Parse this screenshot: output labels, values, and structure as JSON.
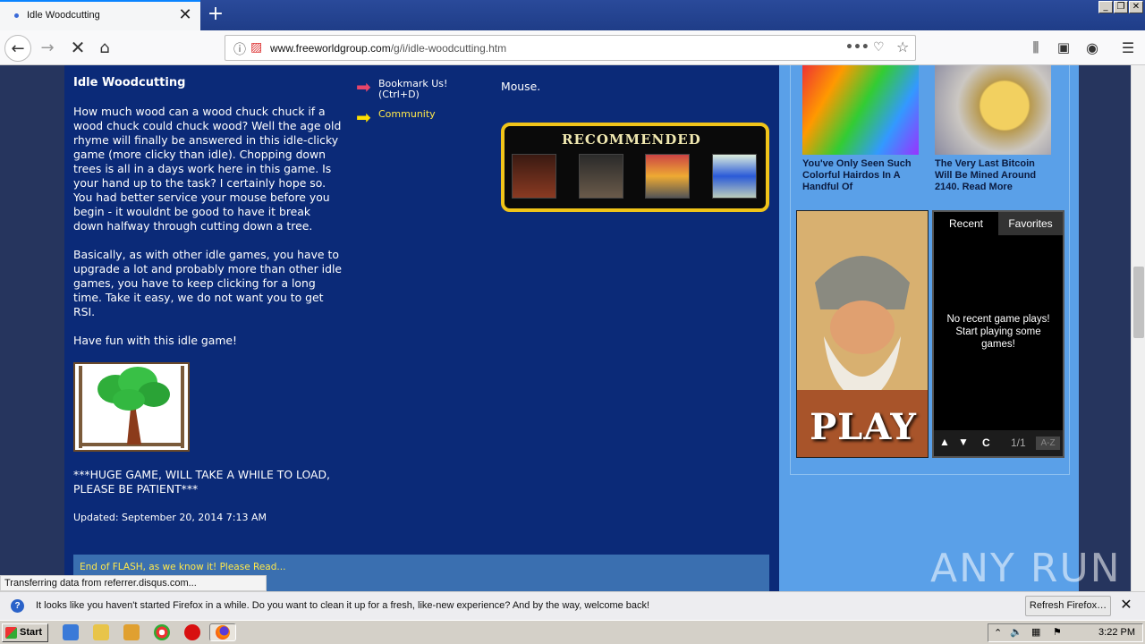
{
  "browser": {
    "tab_title": "Idle Woodcutting",
    "url_domain": "www.freeworldgroup.com",
    "url_path": "/g/i/idle-woodcutting.htm",
    "status": "Transferring data from referrer.disqus.com...",
    "accent": "#0a84ff"
  },
  "article": {
    "title": "Idle Woodcutting",
    "paragraphs": [
      "How much wood can a wood chuck chuck if a wood chuck could chuck wood? Well the age old rhyme will finally be answered in this idle-clicky game (more clicky than idle). Chopping down trees is all in a days work here in this game. Is your hand up to the task? I certainly hope so. You had better service your mouse before you begin - it wouldnt be good to have it break down halfway through cutting down a tree.",
      "Basically, as with other idle games, you have to upgrade a lot and probably more than other idle games, you have to keep clicking for a long time. Take it easy, we do not want you to get RSI.",
      "Have fun with this idle game!"
    ],
    "warning": "***HUGE GAME, WILL TAKE A WHILE TO LOAD, PLEASE BE PATIENT***",
    "updated": "Updated: September 20, 2014 7:13 AM",
    "controls_tail": "Mouse."
  },
  "sidebar_links": {
    "bookmark": "Bookmark Us!",
    "bookmark_shortcut": "(Ctrl+D)",
    "community": "Community"
  },
  "recommended": {
    "title": "RECOMMENDED"
  },
  "flash_notice": "End of FLASH, as we know it! Please Read...",
  "ads": [
    {
      "caption": "You've Only Seen Such Colorful Hairdos In A Handful Of"
    },
    {
      "caption": "The Very Last Bitcoin Will Be Mined Around 2140. Read More"
    }
  ],
  "play_label": "PLAY",
  "recent_widget": {
    "tab_recent": "Recent",
    "tab_favorites": "Favorites",
    "empty_message": "No recent game plays! Start playing some games!",
    "clear": "C",
    "page": "1/1",
    "sort": "A-Z"
  },
  "notification": {
    "message": "It looks like you haven't started Firefox in a while. Do you want to clean it up for a fresh, like-new experience? And by the way, welcome back!",
    "button": "Refresh Firefox…"
  },
  "taskbar": {
    "start": "Start",
    "clock": "3:22 PM"
  },
  "watermark": "ANY RUN"
}
